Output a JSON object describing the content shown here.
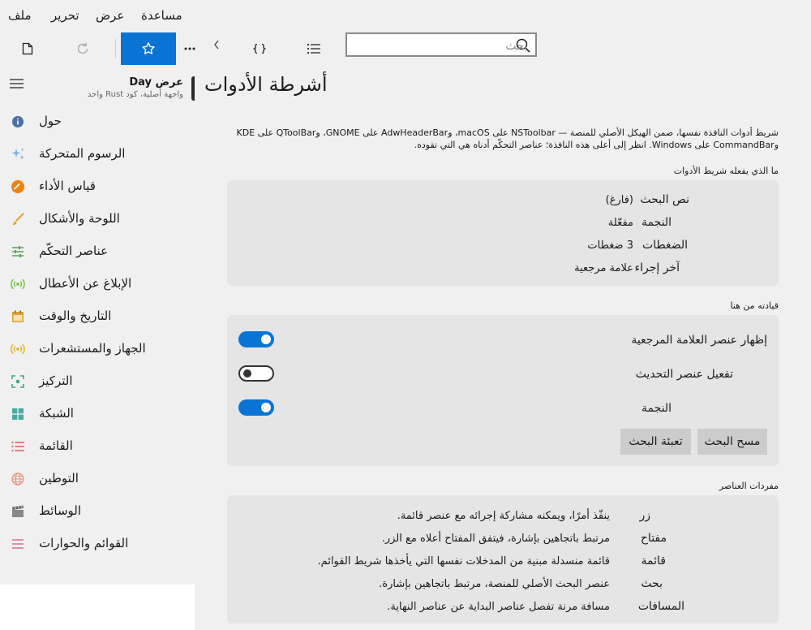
{
  "menu": {
    "file": "ملف",
    "edit": "تحرير",
    "view": "عرض",
    "help": "مساعدة"
  },
  "search": {
    "placeholder": "بحث"
  },
  "sidebar": {
    "title": "عرض Day",
    "subtitle": "واجهة أصلية، كود Rust واحد",
    "items": [
      {
        "label": "حول",
        "icon": "info-icon"
      },
      {
        "label": "الرسوم المتحركة",
        "icon": "sparkle-icon"
      },
      {
        "label": "قياس الأداء",
        "icon": "gauge-icon"
      },
      {
        "label": "اللوحة والأشكال",
        "icon": "brush-icon"
      },
      {
        "label": "عناصر التحكّم",
        "icon": "sliders-icon"
      },
      {
        "label": "الإبلاغ عن الأعطال",
        "icon": "broadcast-icon"
      },
      {
        "label": "التاريخ والوقت",
        "icon": "calendar-icon"
      },
      {
        "label": "الجهاز والمستشعرات",
        "icon": "sensor-icon"
      },
      {
        "label": "التركيز",
        "icon": "focus-icon"
      },
      {
        "label": "الشبكة",
        "icon": "grid-icon"
      },
      {
        "label": "القائمة",
        "icon": "list-icon"
      },
      {
        "label": "التوطين",
        "icon": "globe-icon"
      },
      {
        "label": "الوسائط",
        "icon": "clapper-icon"
      },
      {
        "label": "القوائم والحوارات",
        "icon": "menu-lines-icon"
      }
    ]
  },
  "page": {
    "title": "أشرطة الأدوات",
    "description_line1": "شريط أدوات النافذة نفسها، ضمن الهيكل الأصلي للمنصة — NSToolbar على macOS، وAdwHeaderBar على GNOME، وQToolBar على KDE",
    "description_line2": "وCommandBar على Windows. انظر إلى أعلى هذه النافذة؛ عناصر التحكّم أدناه هي التي تقوده."
  },
  "what_it_does": {
    "title": "ما الذي يفعله شريط الأدوات",
    "rows": [
      {
        "label": "نص البحث",
        "value": "(فارغ)"
      },
      {
        "label": "النجمة",
        "value": "مفعّلة"
      },
      {
        "label": "الضغطات",
        "value": "3 ضغطات"
      },
      {
        "label": "آخر إجراء",
        "value": "علامة مرجعية"
      }
    ]
  },
  "drive": {
    "title": "قيادته من هنا",
    "toggles": [
      {
        "label": "إظهار عنصر العلامة المرجعية",
        "on": true
      },
      {
        "label": "تفعيل عنصر التحديث",
        "on": false
      },
      {
        "label": "النجمة",
        "on": true
      }
    ],
    "clear_button": "مسح البحث",
    "fill_button": "تعبئة البحث"
  },
  "vocab": {
    "title": "مفردات العناصر",
    "rows": [
      {
        "label": "زر",
        "value": "ينفّذ أمرًا، ويمكنه مشاركة إجرائه مع عنصر قائمة."
      },
      {
        "label": "مفتاح",
        "value": "مرتبط باتجاهين بإشارة، فيتفق المفتاح أعلاه مع الزر."
      },
      {
        "label": "قائمة",
        "value": "قائمة منسدلة مبنية من المدخلات نفسها التي يأخذها شريط القوائم."
      },
      {
        "label": "بحث",
        "value": "عنصر البحث الأصلي للمنصة، مرتبط باتجاهين بإشارة."
      },
      {
        "label": "المسافات",
        "value": "مسافة مرنة تفصل عناصر البداية عن عناصر النهاية."
      }
    ]
  },
  "colors": {
    "accent": "#0a74d4",
    "chrome": "#f0f0f0",
    "card": "#e5e5e5",
    "button": "#cccccc"
  }
}
